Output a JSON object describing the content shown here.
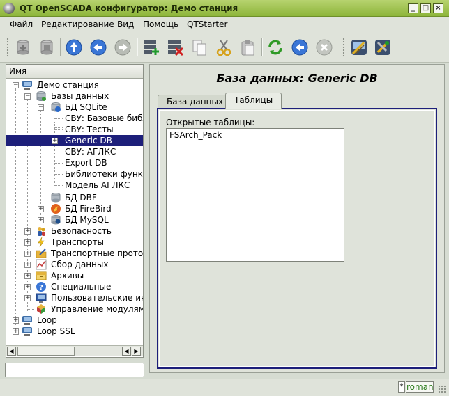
{
  "window": {
    "title": "QT OpenSCADA конфигуратор: Демо станция",
    "btn_min": "_",
    "btn_max": "□",
    "btn_close": "×"
  },
  "menu": {
    "file": "Файл",
    "edit": "Редактирование",
    "view": "Вид",
    "help": "Помощь",
    "qtstarter": "QTStarter"
  },
  "toolbar": {
    "icons": [
      "db-load-icon",
      "db-save-icon",
      "up-icon",
      "back-icon",
      "forward-icon",
      "add-item-icon",
      "delete-item-icon",
      "copy-icon",
      "cut-icon",
      "paste-icon",
      "refresh-icon",
      "start-icon",
      "stop-icon",
      "config-icon",
      "tools-icon"
    ]
  },
  "tree": {
    "header": "Имя",
    "items": [
      {
        "label": "Демо станция"
      },
      {
        "label": "Базы данных"
      },
      {
        "label": "БД SQLite"
      },
      {
        "label": "СВУ: Базовые библ"
      },
      {
        "label": "СВУ: Тесты"
      },
      {
        "label": "Generic DB"
      },
      {
        "label": "СВУ: АГЛКС"
      },
      {
        "label": "Export DB"
      },
      {
        "label": "Библиотеки функци"
      },
      {
        "label": "Модель АГЛКС"
      },
      {
        "label": "БД DBF"
      },
      {
        "label": "БД FireBird"
      },
      {
        "label": "БД MySQL"
      },
      {
        "label": "Безопасность"
      },
      {
        "label": "Транспорты"
      },
      {
        "label": "Транспортные протоко"
      },
      {
        "label": "Сбор данных"
      },
      {
        "label": "Архивы"
      },
      {
        "label": "Специальные"
      },
      {
        "label": "Пользовательские инт"
      },
      {
        "label": "Управление модулями"
      },
      {
        "label": "Loop"
      },
      {
        "label": "Loop SSL"
      }
    ],
    "selected": "Generic DB"
  },
  "panel": {
    "title": "База данных: Generic DB",
    "tabs": [
      {
        "label": "База данных"
      },
      {
        "label": "Таблицы"
      }
    ],
    "active_tab": "Таблицы",
    "open_tables_label": "Открытые таблицы:",
    "open_tables": [
      "FSArch_Pack"
    ]
  },
  "status": {
    "modified_marker": "*",
    "user": "roman"
  },
  "colors": {
    "titlebar": "#9bc04a",
    "selection": "#1d1f7a",
    "user_text": "#2e7d1f"
  }
}
